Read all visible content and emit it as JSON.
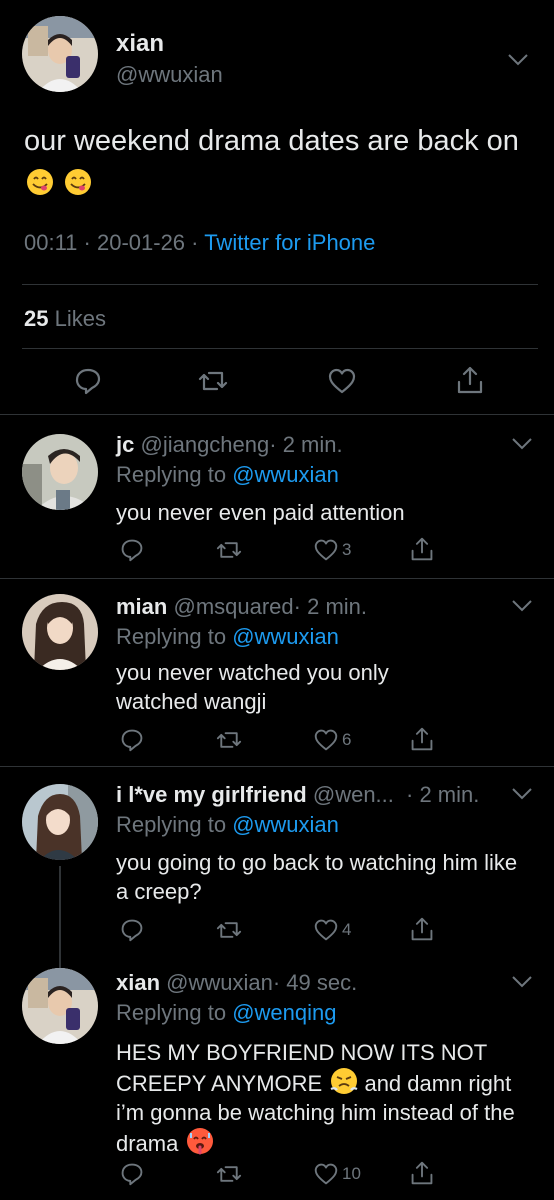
{
  "main_tweet": {
    "name": "xian",
    "handle": "@wwuxian",
    "text": "our weekend drama dates are back on",
    "emojis": [
      "yum-emoji",
      "yum-emoji"
    ],
    "time": "00:11 · 20-01-26 · ",
    "source": "Twitter for iPhone",
    "likes_count": "25",
    "likes_label": " Likes"
  },
  "replies": [
    {
      "name": "jc",
      "handle": "@jiangcheng",
      "time": "· 2 min.",
      "replying_label": "Replying to ",
      "replying_to": "@wwuxian",
      "text": "you never even paid attention",
      "like_count": "3"
    },
    {
      "name": "mian",
      "handle": "@msquared",
      "time": "· 2 min.",
      "replying_label": "Replying to ",
      "replying_to": "@wwuxian",
      "text": "you never watched you only watched wangji",
      "like_count": "6"
    },
    {
      "name": "i l*ve my girlfriend",
      "handle": "@wen...",
      "time": "· 2 min.",
      "replying_label": "Replying to ",
      "replying_to": "@wwuxian",
      "text": "you going to go back to watching him like a creep?",
      "like_count": "4"
    },
    {
      "name": "xian",
      "handle": "@wwuxian",
      "time": "· 49 sec.",
      "replying_label": "Replying to ",
      "replying_to": "@wenqing",
      "text_a": "HES MY BOYFRIEND NOW ITS NOT CREEPY ANYMORE",
      "text_b": " and damn right i’m gonna be watching him instead of the drama",
      "like_count": "10"
    }
  ],
  "colors": {
    "background": "#000000",
    "text": "#e7e9ea",
    "muted": "#6e767d",
    "link": "#1d9bf0",
    "divider": "#2f3336"
  }
}
